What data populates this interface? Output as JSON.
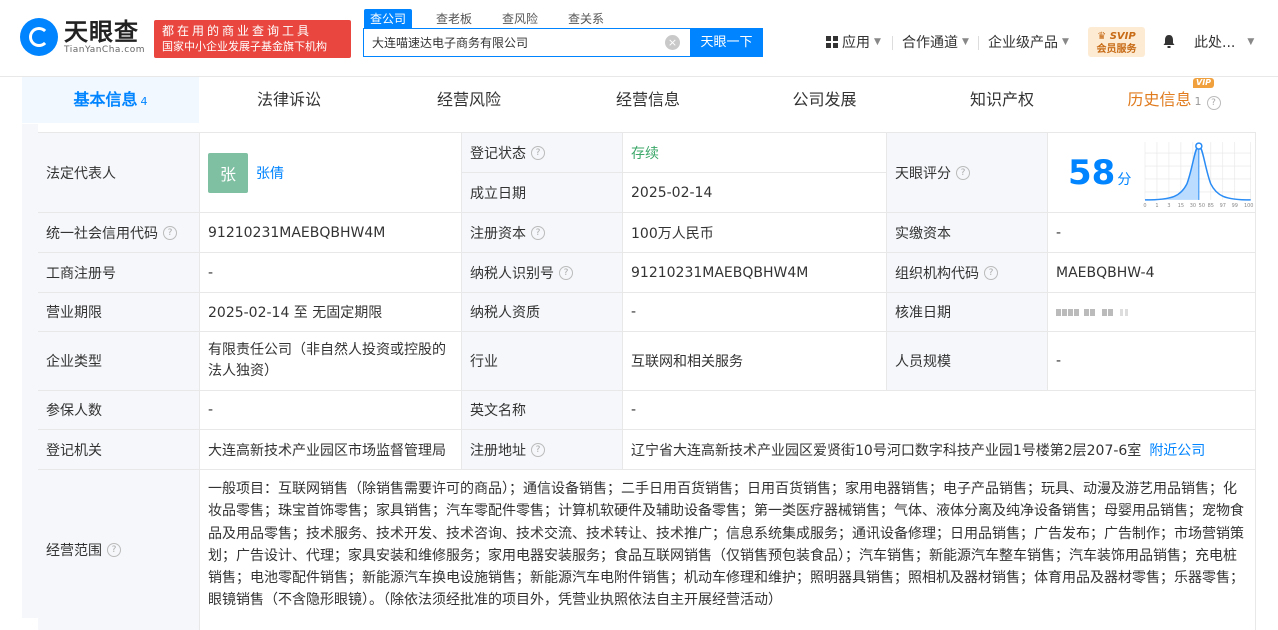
{
  "header": {
    "logo_cn": "天眼查",
    "logo_en": "TianYanCha.com",
    "banner_line1": "都在用的商业查询工具",
    "banner_line2": "国家中小企业发展子基金旗下机构",
    "search_tabs": [
      "查公司",
      "查老板",
      "查风险",
      "查关系"
    ],
    "search_value": "大连喵速达电子商务有限公司",
    "search_button": "天眼一下",
    "nav": {
      "apps": "应用",
      "cooperation": "合作通道",
      "enterprise": "企业级产品",
      "svip_line1": "SVIP",
      "svip_line2": "会员服务",
      "user": "此处..."
    }
  },
  "tabs": [
    {
      "label": "基本信息",
      "count": "4"
    },
    {
      "label": "法律诉讼"
    },
    {
      "label": "经营风险"
    },
    {
      "label": "经营信息"
    },
    {
      "label": "公司发展"
    },
    {
      "label": "知识产权"
    },
    {
      "label": "历史信息",
      "count": "1",
      "badge": "VIP"
    }
  ],
  "info": {
    "legal_rep_label": "法定代表人",
    "legal_rep_avatar": "张",
    "legal_rep_name": "张倩",
    "reg_status_label": "登记状态",
    "reg_status": "存续",
    "founded_label": "成立日期",
    "founded": "2025-02-14",
    "score_label": "天眼评分",
    "score": "58",
    "score_unit": "分",
    "score_axis": [
      "0",
      "1",
      "3",
      "15",
      "30",
      "50",
      "85",
      "97",
      "99",
      "100"
    ],
    "credit_code_label": "统一社会信用代码",
    "credit_code": "91210231MAEBQBHW4M",
    "reg_capital_label": "注册资本",
    "reg_capital": "100万人民币",
    "paid_capital_label": "实缴资本",
    "paid_capital": "-",
    "biz_reg_no_label": "工商注册号",
    "biz_reg_no": "-",
    "taxpayer_id_label": "纳税人识别号",
    "taxpayer_id": "91210231MAEBQBHW4M",
    "org_code_label": "组织机构代码",
    "org_code": "MAEBQBHW-4",
    "biz_term_label": "营业期限",
    "biz_term": "2025-02-14 至 无固定期限",
    "taxpayer_qual_label": "纳税人资质",
    "taxpayer_qual": "-",
    "approval_date_label": "核准日期",
    "company_type_label": "企业类型",
    "company_type": "有限责任公司（非自然人投资或控股的法人独资）",
    "industry_label": "行业",
    "industry": "互联网和相关服务",
    "staff_size_label": "人员规模",
    "staff_size": "-",
    "insured_label": "参保人数",
    "insured": "-",
    "english_name_label": "英文名称",
    "english_name": "-",
    "reg_authority_label": "登记机关",
    "reg_authority": "大连高新技术产业园区市场监督管理局",
    "reg_address_label": "注册地址",
    "reg_address": "辽宁省大连高新技术产业园区爱贤街10号河口数字科技产业园1号楼第2层207-6室",
    "nearby_link": "附近公司",
    "biz_scope_label": "经营范围",
    "biz_scope": "一般项目：互联网销售（除销售需要许可的商品）；通信设备销售；二手日用百货销售；日用百货销售；家用电器销售；电子产品销售；玩具、动漫及游艺用品销售；化妆品零售；珠宝首饰零售；家具销售；汽车零配件零售；计算机软硬件及辅助设备零售；第一类医疗器械销售；气体、液体分离及纯净设备销售；母婴用品销售；宠物食品及用品零售；技术服务、技术开发、技术咨询、技术交流、技术转让、技术推广；信息系统集成服务；通讯设备修理；日用品销售；广告发布；广告制作；市场营销策划；广告设计、代理；家具安装和维修服务；家用电器安装服务；食品互联网销售（仅销售预包装食品）；汽车销售；新能源汽车整车销售；汽车装饰用品销售；充电桩销售；电池零配件销售；新能源汽车换电设施销售；新能源汽车电附件销售；机动车修理和维护；照明器具销售；照相机及器材销售；体育用品及器材零售；乐器零售；眼镜销售（不含隐形眼镜）。（除依法须经批准的项目外，凭营业执照依法自主开展经营活动）"
  },
  "colors": {
    "brand": "#0084ff",
    "banner": "#e8463e",
    "status_green": "#3da86a",
    "label_bg": "#f5f7fa"
  }
}
